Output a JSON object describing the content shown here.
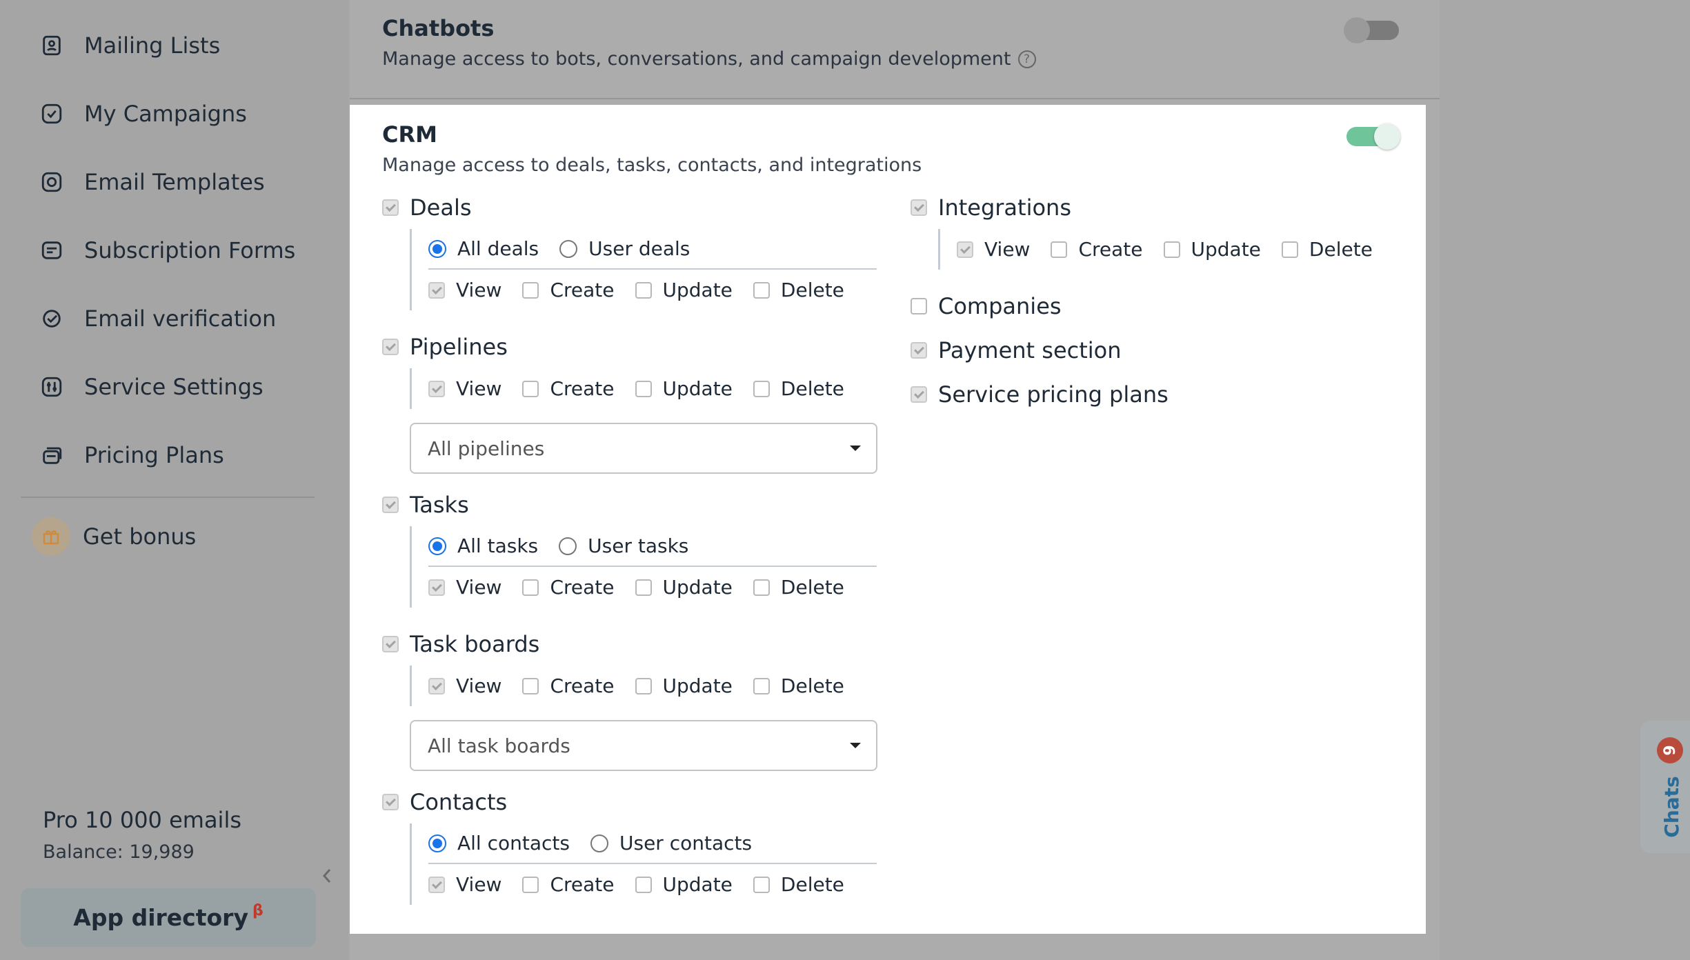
{
  "sidebar": {
    "items": [
      {
        "label": "Mailing Lists",
        "icon": "mailing-list-icon"
      },
      {
        "label": "My Campaigns",
        "icon": "campaign-icon"
      },
      {
        "label": "Email Templates",
        "icon": "template-icon"
      },
      {
        "label": "Subscription Forms",
        "icon": "form-icon"
      },
      {
        "label": "Email verification",
        "icon": "verify-icon"
      },
      {
        "label": "Service Settings",
        "icon": "settings-icon"
      },
      {
        "label": "Pricing Plans",
        "icon": "pricing-icon"
      }
    ],
    "bonus": {
      "label": "Get bonus",
      "icon": "gift-icon"
    },
    "plan": {
      "name": "Pro 10 000 emails",
      "balance": "Balance: 19,989"
    },
    "app_directory": {
      "label": "App directory",
      "badge": "β"
    }
  },
  "chatbots": {
    "title": "Chatbots",
    "description": "Manage access to bots, conversations, and campaign development",
    "help": "?",
    "enabled": false
  },
  "crm": {
    "title": "CRM",
    "description": "Manage access to deals, tasks, contacts, and integrations",
    "enabled": true,
    "perm_labels": {
      "view": "View",
      "create": "Create",
      "update": "Update",
      "delete": "Delete"
    },
    "deals": {
      "label": "Deals",
      "radio_all": "All deals",
      "radio_user": "User deals"
    },
    "pipelines": {
      "label": "Pipelines",
      "select": "All pipelines"
    },
    "tasks": {
      "label": "Tasks",
      "radio_all": "All tasks",
      "radio_user": "User tasks"
    },
    "task_boards": {
      "label": "Task boards",
      "select": "All task boards"
    },
    "contacts": {
      "label": "Contacts",
      "radio_all": "All contacts",
      "radio_user": "User contacts"
    },
    "integrations": {
      "label": "Integrations"
    },
    "companies": {
      "label": "Companies"
    },
    "payment_section": {
      "label": "Payment section"
    },
    "service_pricing_plans": {
      "label": "Service pricing plans"
    }
  },
  "chats": {
    "label": "Chats",
    "count": "9"
  },
  "colors": {
    "accent": "#1a73e8",
    "toggle_on": "#6fc49a",
    "badge": "#b84b3b"
  }
}
